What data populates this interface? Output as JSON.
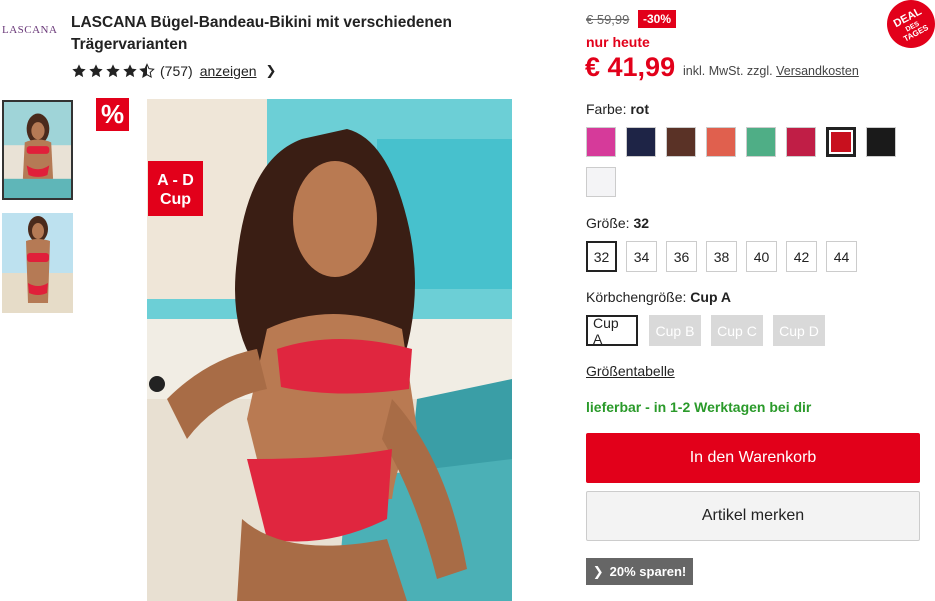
{
  "brand": {
    "logo_text": "LASCANA"
  },
  "product": {
    "title": "LASCANA Bügel-Bandeau-Bikini mit verschiedenen Trägervarianten",
    "rating_count": "(757)",
    "rating_value": 4.5,
    "rating_link": "anzeigen",
    "sale_badge": "%",
    "cup_badge_line1": "A - D",
    "cup_badge_line2": "Cup"
  },
  "pricing": {
    "old_price": "€ 59,99",
    "discount": "-30%",
    "deal_badge_line1": "DEAL",
    "deal_badge_line2": "DES",
    "deal_badge_line3": "TAGES",
    "today_label": "nur heute",
    "price": "€ 41,99",
    "tax_text": "inkl. MwSt. zzgl.",
    "shipping_link": "Versandkosten"
  },
  "color": {
    "label": "Farbe:",
    "selected": "rot",
    "swatches": [
      {
        "name": "pink",
        "hex": "#d63a9a"
      },
      {
        "name": "navy",
        "hex": "#1e2446"
      },
      {
        "name": "brown",
        "hex": "#5a3226"
      },
      {
        "name": "coral",
        "hex": "#e0604e"
      },
      {
        "name": "mint",
        "hex": "#4fae86"
      },
      {
        "name": "berry",
        "hex": "#c01e46"
      },
      {
        "name": "red",
        "hex": "#c8101e"
      },
      {
        "name": "black",
        "hex": "#1a1a1a"
      },
      {
        "name": "white",
        "hex": "#f4f4f6"
      }
    ]
  },
  "size": {
    "label": "Größe:",
    "selected": "32",
    "options": [
      "32",
      "34",
      "36",
      "38",
      "40",
      "42",
      "44"
    ]
  },
  "cup": {
    "label": "Körbchengröße:",
    "selected": "Cup A",
    "options": [
      "Cup A",
      "Cup B",
      "Cup C",
      "Cup D"
    ]
  },
  "size_table_link": "Größentabelle",
  "availability": "lieferbar - in 1-2 Werktagen bei dir",
  "actions": {
    "add_to_cart": "In den Warenkorb",
    "wishlist": "Artikel merken",
    "save_label": "20% sparen!"
  },
  "colors": {
    "accent": "#e2001a",
    "available": "#2a9a2a"
  }
}
